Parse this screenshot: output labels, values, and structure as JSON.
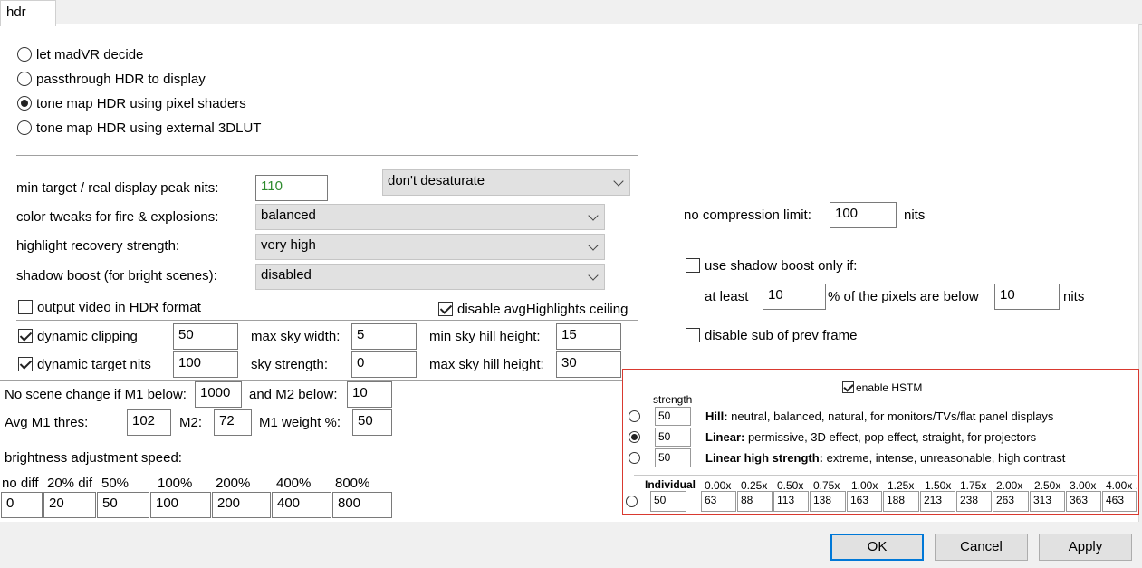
{
  "tab": {
    "label": "hdr"
  },
  "hdr_mode": {
    "options": [
      "let madVR decide",
      "passthrough HDR to display",
      "tone map HDR using pixel shaders",
      "tone map HDR using external 3DLUT"
    ],
    "selected_index": 2
  },
  "settings": {
    "min_target_label": "min target / real display peak nits:",
    "min_target_value": "110",
    "desaturate_value": "don't desaturate",
    "color_tweaks_label": "color tweaks for fire & explosions:",
    "color_tweaks_value": "balanced",
    "highlight_label": "highlight recovery strength:",
    "highlight_value": "very high",
    "shadow_label": "shadow boost (for bright scenes):",
    "shadow_value": "disabled",
    "output_hdr_label": "output video in HDR format",
    "output_hdr_checked": false,
    "disable_avg_label": "disable avgHighlights ceiling",
    "disable_avg_checked": true
  },
  "dynamic": {
    "clipping_label": "dynamic clipping",
    "clipping_checked": true,
    "clipping_value": "50",
    "target_label": "dynamic target nits",
    "target_checked": true,
    "target_value": "100",
    "max_sky_width_label": "max sky width:",
    "max_sky_width_value": "5",
    "sky_strength_label": "sky strength:",
    "sky_strength_value": "0",
    "min_hill_label": "min sky hill height:",
    "min_hill_value": "15",
    "max_hill_label": "max sky hill height:",
    "max_hill_value": "30"
  },
  "scene": {
    "m1_label": "No scene change if M1 below:",
    "m1_value": "1000",
    "m2_label": "and M2 below:",
    "m2_value": "10",
    "avg_label": "Avg M1 thres:",
    "avg_value": "102",
    "m2b_label": "M2:",
    "m2b_value": "72",
    "weight_label": "M1 weight %:",
    "weight_value": "50"
  },
  "brightness": {
    "title": "brightness adjustment speed:",
    "headers": [
      "no diff",
      "20% dif",
      "50%",
      "100%",
      "200%",
      "400%",
      "800%"
    ],
    "values": [
      "0",
      "20",
      "50",
      "100",
      "200",
      "400",
      "800"
    ]
  },
  "right": {
    "no_comp_label": "no compression limit:",
    "no_comp_value": "100",
    "nits": "nits",
    "shadow_only_label": "use shadow boost only if:",
    "shadow_only_checked": false,
    "at_least_label": "at least",
    "at_least_value": "10",
    "pixels_label": "% of the pixels are below",
    "pixels_value": "10",
    "nits2": "nits",
    "disable_sub_label": "disable sub of prev frame",
    "disable_sub_checked": false
  },
  "hstm": {
    "enable_label": "enable HSTM",
    "enable_checked": true,
    "strength_header": "strength",
    "rows": [
      {
        "strength": "50",
        "title": "Hill:",
        "desc": " neutral, balanced, natural, for monitors/TVs/flat panel displays",
        "selected": false
      },
      {
        "strength": "50",
        "title": "Linear:",
        "desc": " permissive, 3D effect, pop effect, straight, for projectors",
        "selected": true
      },
      {
        "strength": "50",
        "title": "Linear high strength:",
        "desc": " extreme, intense, unreasonable, high contrast",
        "selected": false
      }
    ],
    "individual_label": "Individual",
    "individual_strength": "50",
    "individual_headers": [
      "0.00x",
      "0.25x",
      "0.50x",
      "0.75x",
      "1.00x",
      "1.25x",
      "1.50x",
      "1.75x",
      "2.00x",
      "2.50x",
      "3.00x",
      "4.00x ."
    ],
    "individual_values": [
      "63",
      "88",
      "113",
      "138",
      "163",
      "188",
      "213",
      "238",
      "263",
      "313",
      "363",
      "463"
    ]
  },
  "buttons": {
    "ok": "OK",
    "cancel": "Cancel",
    "apply": "Apply"
  }
}
